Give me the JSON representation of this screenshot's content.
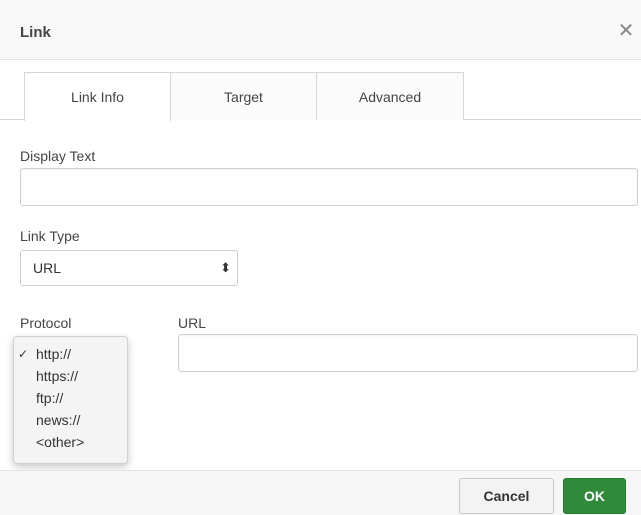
{
  "dialog": {
    "title": "Link",
    "close_icon": "close-icon",
    "close_glyph": "✕"
  },
  "tabs": [
    {
      "label": "Link Info",
      "active": true
    },
    {
      "label": "Target",
      "active": false
    },
    {
      "label": "Advanced",
      "active": false
    }
  ],
  "form": {
    "display_text_label": "Display Text",
    "display_text_value": "",
    "link_type_label": "Link Type",
    "link_type_value": "URL",
    "protocol_label": "Protocol",
    "url_label": "URL",
    "url_value": ""
  },
  "protocol_dropdown": {
    "options": [
      "http://",
      "https://",
      "ftp://",
      "news://",
      "<other>"
    ],
    "selected_index": 0,
    "check_glyph": "✓"
  },
  "footer": {
    "cancel_label": "Cancel",
    "ok_label": "OK"
  },
  "colors": {
    "ok_button": "#2f8a3a",
    "titlebar_bg": "#f8f8f8"
  }
}
